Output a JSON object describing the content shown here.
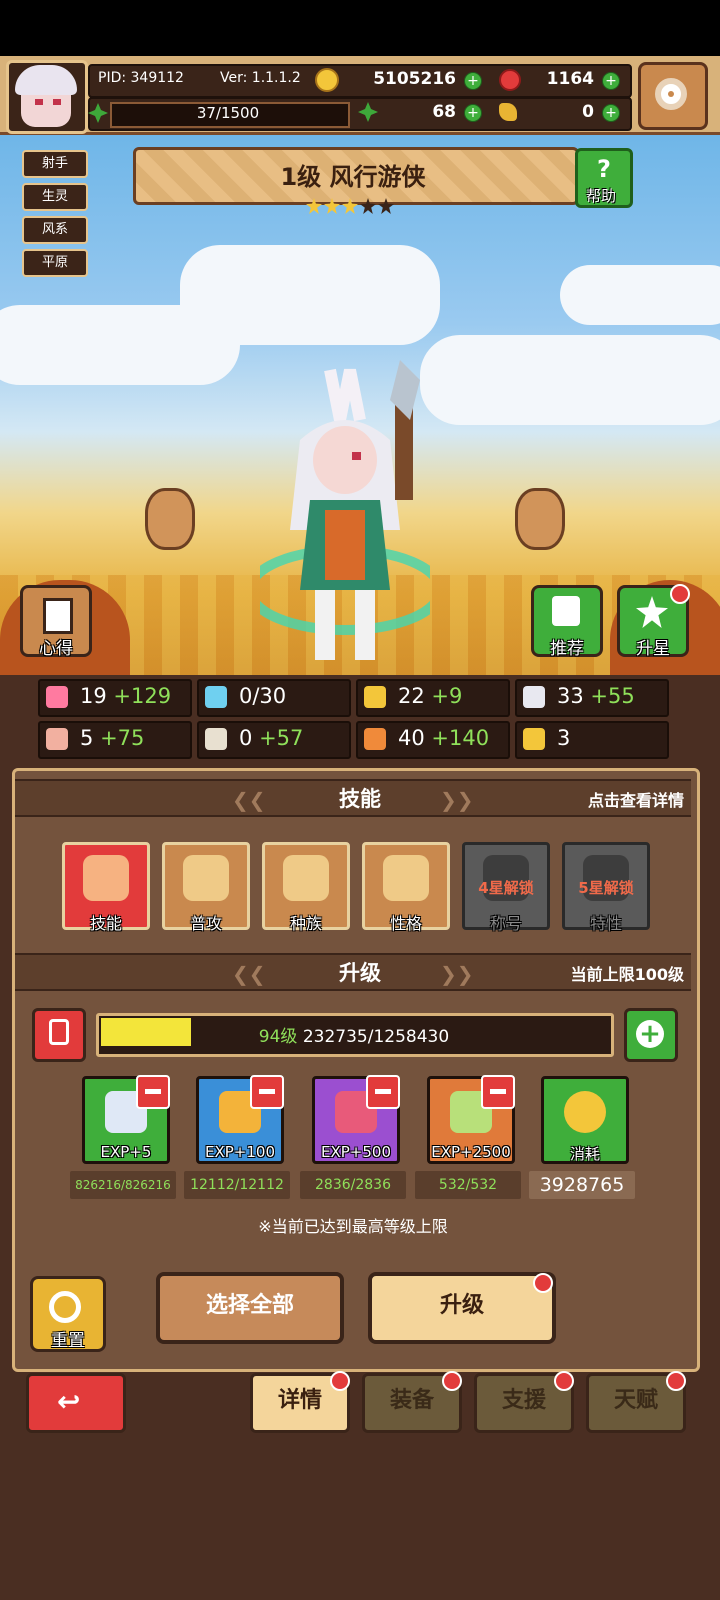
{
  "topbar": {
    "pid": "PID: 349112",
    "version": "Ver: 1.1.1.2",
    "gold": "5105216",
    "ruby": "1164",
    "clover": "68",
    "potion": "0",
    "stamina": "37/1500"
  },
  "tags": [
    "射手",
    "生灵",
    "风系",
    "平原"
  ],
  "hero": {
    "name": "1级 风行游侠",
    "stars_filled": 3,
    "stars_total": 5
  },
  "help_label": "帮助",
  "side_buttons": {
    "notes": "心得",
    "recommend": "推荐",
    "star_up": "升星"
  },
  "stats": [
    {
      "icon": "heart-icon",
      "base": "19",
      "bonus": "+129"
    },
    {
      "icon": "water-drop-icon",
      "base": "0/30",
      "bonus": ""
    },
    {
      "icon": "shield-icon",
      "base": "22",
      "bonus": "+9"
    },
    {
      "icon": "wing-icon",
      "base": "33",
      "bonus": "+55"
    },
    {
      "icon": "fist-icon",
      "base": "5",
      "bonus": "+75"
    },
    {
      "icon": "book-icon",
      "base": "0",
      "bonus": "+57"
    },
    {
      "icon": "speed-icon",
      "base": "40",
      "bonus": "+140"
    },
    {
      "icon": "horseshoe-icon",
      "base": "3",
      "bonus": ""
    }
  ],
  "skills_section": {
    "title": "技能",
    "hint": "点击查看详情",
    "items": [
      {
        "label": "技能",
        "locked": false,
        "lock_text": ""
      },
      {
        "label": "普攻",
        "locked": false,
        "lock_text": ""
      },
      {
        "label": "种族",
        "locked": false,
        "lock_text": ""
      },
      {
        "label": "性格",
        "locked": false,
        "lock_text": ""
      },
      {
        "label": "称号",
        "locked": true,
        "lock_text": "4星解锁"
      },
      {
        "label": "特性",
        "locked": true,
        "lock_text": "5星解锁"
      }
    ]
  },
  "upgrade_section": {
    "title": "升级",
    "hint": "当前上限100级",
    "level_text": "94级",
    "exp_text": "232735/1258430",
    "exp_progress": 0.18,
    "items": [
      {
        "label": "EXP+5",
        "count": "826216/826216",
        "color": "#3fae3b"
      },
      {
        "label": "EXP+100",
        "count": "12112/12112",
        "color": "#3a8fd8"
      },
      {
        "label": "EXP+500",
        "count": "2836/2836",
        "color": "#9b4fd0"
      },
      {
        "label": "EXP+2500",
        "count": "532/532",
        "color": "#e07a3a"
      },
      {
        "label": "消耗",
        "count": "3928765",
        "color": "#3fae3b"
      }
    ],
    "note": "※当前已达到最高等级上限"
  },
  "actions": {
    "reset": "重置",
    "select_all": "选择全部",
    "upgrade": "升级"
  },
  "tabs": [
    "详情",
    "装备",
    "支援",
    "天赋"
  ],
  "colors": {
    "accent_green": "#8fe05a",
    "panel_brown": "#74533d",
    "gold_border": "#d8b27a",
    "red": "#e23b3b"
  }
}
